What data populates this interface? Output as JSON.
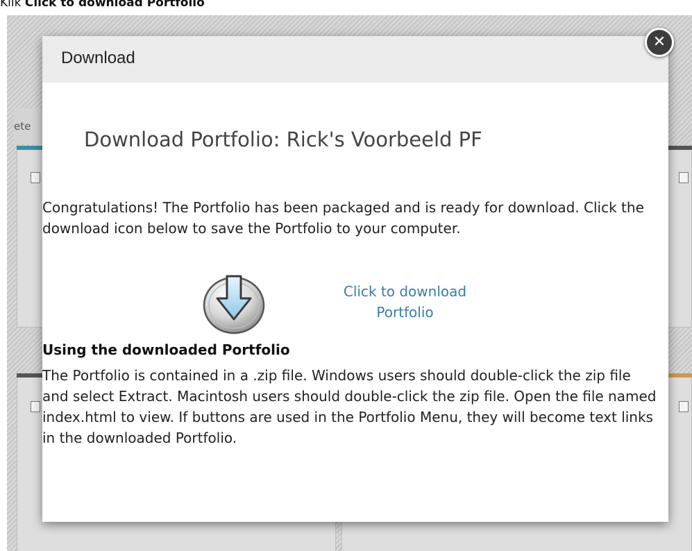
{
  "caption": {
    "prefix": "Klik ",
    "bold": "Click to download Portfolio"
  },
  "background": {
    "tab_label": "ete"
  },
  "modal": {
    "title": "Download",
    "close_symbol": "✕",
    "heading": "Download Portfolio: Rick's Voorbeeld PF",
    "intro": "Congratulations! The Portfolio has been packaged and is ready for download. Click the download icon below to save the Portfolio to your computer.",
    "download_icon": "download-arrow-icon",
    "download_link": "Click to download Portfolio",
    "using_heading": "Using the downloaded Portfolio",
    "using_text": "The Portfolio is contained in a .zip file. Windows users should double-click the zip file and select Extract. Macintosh users should double-click the zip file. Open the file named index.html to view. If buttons are used in the Portfolio Menu, they will become text links in the downloaded Portfolio."
  },
  "colors": {
    "link": "#3a7ca8",
    "header_bg": "#ebebeb",
    "accent_teal": "#3b8fa5",
    "accent_orange": "#c99a4f",
    "accent_dark": "#555555"
  }
}
